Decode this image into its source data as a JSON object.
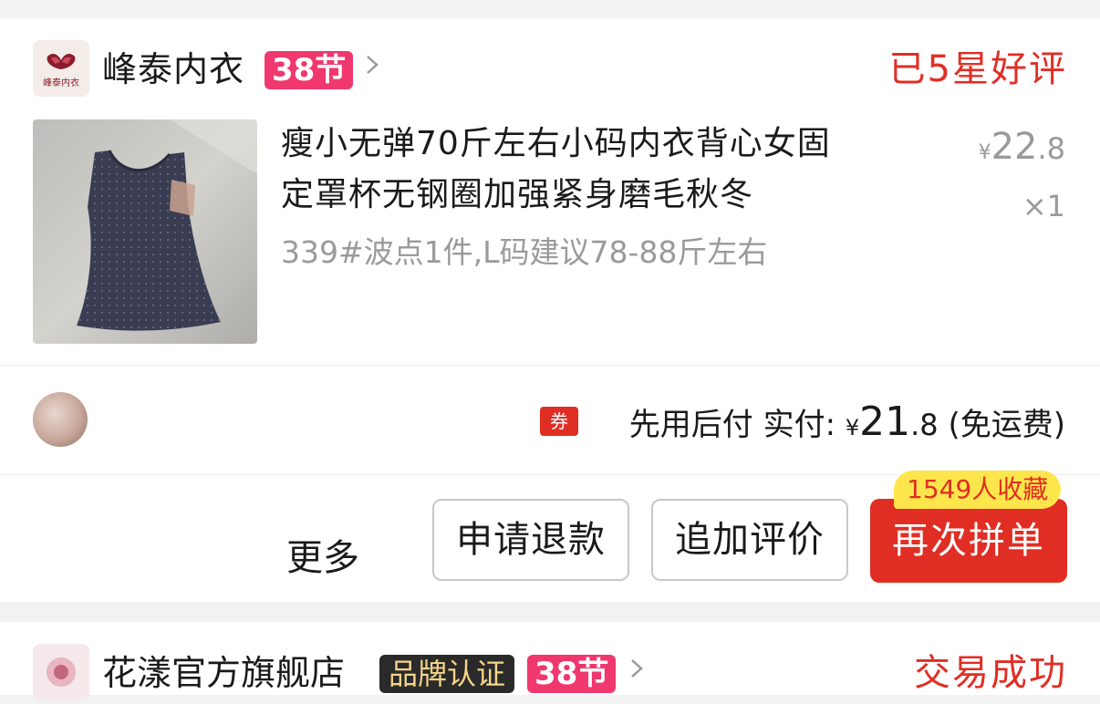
{
  "orders": [
    {
      "shop_name": "峰泰内衣",
      "shop_logo_text": "峰泰内衣",
      "promo_tag": "38节",
      "status": "已5星好评",
      "product": {
        "title_line1": "瘦小无弹70斤左右小码内衣背心女固",
        "title_line2": "定罩杯无钢圈加强紧身磨毛秋冬",
        "sku": "339#波点1件,L码建议78-88斤左右",
        "price_symbol": "¥",
        "price_int": "22",
        "price_dec": ".8",
        "quantity": "×1"
      },
      "payment": {
        "coupon_label": "券",
        "pay_label": "先用后付 实付:",
        "currency": "¥",
        "amount_int": "21",
        "amount_dec": ".8",
        "shipping_note": "(免运费)"
      },
      "actions": {
        "more": "更多",
        "refund": "申请退款",
        "add_review": "追加评价",
        "reorder": "再次拼单",
        "favorites_badge": "1549人收藏"
      }
    },
    {
      "shop_name": "花漾官方旗舰店",
      "verify_badge": "品牌认证",
      "promo_tag": "38节",
      "status": "交易成功"
    }
  ],
  "colors": {
    "accent_red": "#e02e24",
    "tag_pink": "#f0386f",
    "badge_yellow": "#fde64b",
    "muted_gray": "#9a9a9a",
    "page_bg": "#f2f2f2"
  }
}
